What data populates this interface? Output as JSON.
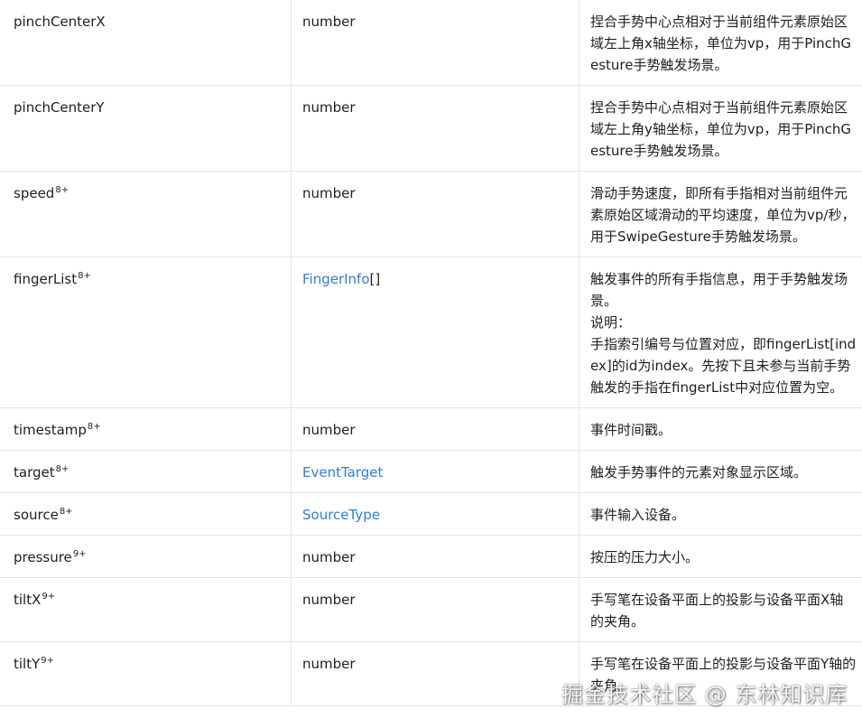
{
  "rows": [
    {
      "name": "pinchCenterX",
      "sup": "",
      "type": "number",
      "type_link": false,
      "desc": [
        "捏合手势中心点相对于当前组件元素原始区域左上角x轴坐标，单位为vp，用于PinchGesture手势触发场景。"
      ]
    },
    {
      "name": "pinchCenterY",
      "sup": "",
      "type": "number",
      "type_link": false,
      "desc": [
        "捏合手势中心点相对于当前组件元素原始区域左上角y轴坐标，单位为vp，用于PinchGesture手势触发场景。"
      ]
    },
    {
      "name": "speed",
      "sup": "8+",
      "type": "number",
      "type_link": false,
      "desc": [
        "滑动手势速度，即所有手指相对当前组件元素原始区域滑动的平均速度，单位为vp/秒，用于SwipeGesture手势触发场景。"
      ]
    },
    {
      "name": "fingerList",
      "sup": "8+",
      "type": "FingerInfo",
      "type_suffix": "[]",
      "type_link": true,
      "desc": [
        "触发事件的所有手指信息，用于手势触发场景。",
        "说明：",
        "手指索引编号与位置对应，即fingerList[index]的id为index。先按下且未参与当前手势触发的手指在fingerList中对应位置为空。"
      ]
    },
    {
      "name": "timestamp",
      "sup": "8+",
      "type": "number",
      "type_link": false,
      "desc": [
        "事件时间戳。"
      ]
    },
    {
      "name": "target",
      "sup": "8+",
      "type": "EventTarget",
      "type_link": true,
      "desc": [
        "触发手势事件的元素对象显示区域。"
      ]
    },
    {
      "name": "source",
      "sup": "8+",
      "type": "SourceType",
      "type_link": true,
      "desc": [
        "事件输入设备。"
      ]
    },
    {
      "name": "pressure",
      "sup": "9+",
      "type": "number",
      "type_link": false,
      "desc": [
        "按压的压力大小。"
      ]
    },
    {
      "name": "tiltX",
      "sup": "9+",
      "type": "number",
      "type_link": false,
      "desc": [
        "手写笔在设备平面上的投影与设备平面X轴的夹角。"
      ]
    },
    {
      "name": "tiltY",
      "sup": "9+",
      "type": "number",
      "type_link": false,
      "desc": [
        "手写笔在设备平面上的投影与设备平面Y轴的夹角。"
      ]
    }
  ],
  "watermark": "掘金技术社区 @ 东林知识库",
  "colors": {
    "link": "#2f7ed8",
    "text": "#1f1f1f",
    "border": "#e4e4e4"
  }
}
